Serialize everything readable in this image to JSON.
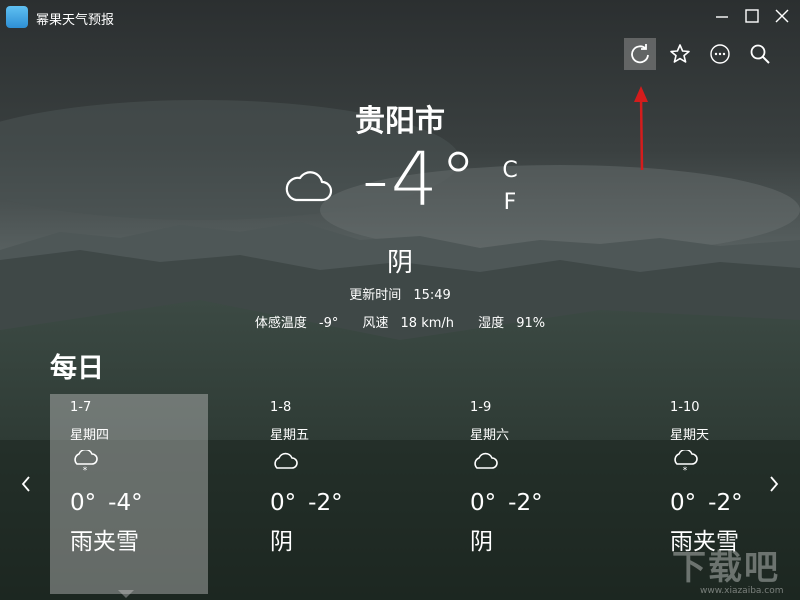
{
  "app": {
    "title": "幂果天气预报"
  },
  "toolbar": {
    "refresh_icon": "refresh-icon",
    "favorite_icon": "star-icon",
    "more_icon": "more-icon",
    "search_icon": "search-icon"
  },
  "current": {
    "city": "贵阳市",
    "temperature": "-4°",
    "unit_c": "C",
    "unit_f": "F",
    "condition": "阴",
    "update_label": "更新时间",
    "update_time": "15:49",
    "feels_like_label": "体感温度",
    "feels_like_value": "-9°",
    "wind_label": "风速",
    "wind_value": "18 km/h",
    "humidity_label": "湿度",
    "humidity_value": "91%"
  },
  "daily": {
    "title": "每日",
    "days": [
      {
        "date": "1-7",
        "weekday": "星期四",
        "icon": "cloud-snow-icon",
        "high": "0°",
        "low": "-4°",
        "condition": "雨夹雪"
      },
      {
        "date": "1-8",
        "weekday": "星期五",
        "icon": "cloud-icon",
        "high": "0°",
        "low": "-2°",
        "condition": "阴"
      },
      {
        "date": "1-9",
        "weekday": "星期六",
        "icon": "cloud-icon",
        "high": "0°",
        "low": "-2°",
        "condition": "阴"
      },
      {
        "date": "1-10",
        "weekday": "星期天",
        "icon": "cloud-snow-icon",
        "high": "0°",
        "low": "-2°",
        "condition": "雨夹雪"
      }
    ]
  },
  "colors": {
    "annotation_arrow": "#d41c1c",
    "selected_card": "#c8c8c8"
  },
  "watermark": {
    "text": "下载吧",
    "url": "www.xiazaiba.com"
  }
}
